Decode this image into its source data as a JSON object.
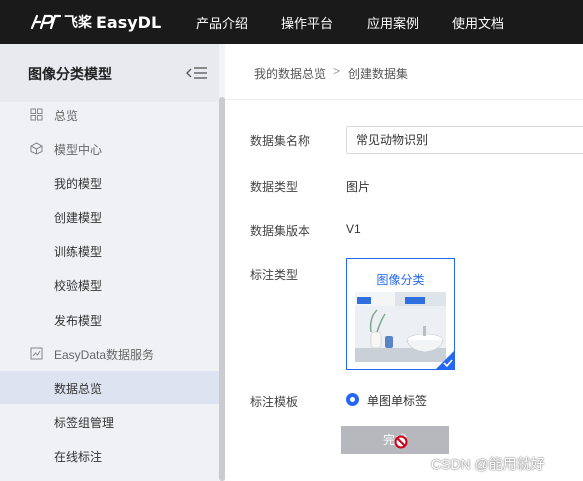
{
  "topnav": {
    "brand_cn": "飞桨",
    "brand_en": "EasyDL",
    "items": [
      {
        "label": "产品介绍"
      },
      {
        "label": "操作平台"
      },
      {
        "label": "应用案例"
      },
      {
        "label": "使用文档"
      }
    ]
  },
  "sidebar": {
    "title": "图像分类模型",
    "items": [
      {
        "label": "总览",
        "icon": "grid-icon"
      },
      {
        "label": "模型中心",
        "icon": "model-icon"
      },
      {
        "label": "我的模型"
      },
      {
        "label": "创建模型"
      },
      {
        "label": "训练模型"
      },
      {
        "label": "校验模型"
      },
      {
        "label": "发布模型"
      },
      {
        "label": "EasyData数据服务",
        "icon": "chart-icon"
      },
      {
        "label": "数据总览",
        "active": true
      },
      {
        "label": "标签组管理"
      },
      {
        "label": "在线标注"
      }
    ]
  },
  "breadcrumb": {
    "parent": "我的数据总览",
    "separator": ">",
    "current": "创建数据集"
  },
  "form": {
    "name_label": "数据集名称",
    "name_value": "常见动物识别",
    "type_label": "数据类型",
    "type_value": "图片",
    "version_label": "数据集版本",
    "version_value": "V1",
    "annotation_label": "标注类型",
    "annotation_option": "图像分类",
    "template_label": "标注模板",
    "template_option": "单图单标签",
    "submit_label": "完成"
  },
  "watermark": "CSDN @能用就好",
  "colors": {
    "accent": "#2468f2",
    "nav_bg": "#1a1a1a",
    "sidebar_bg": "#f0f1f4",
    "active_bg": "#dde3f0",
    "disabled_btn": "#b6b8bd"
  }
}
